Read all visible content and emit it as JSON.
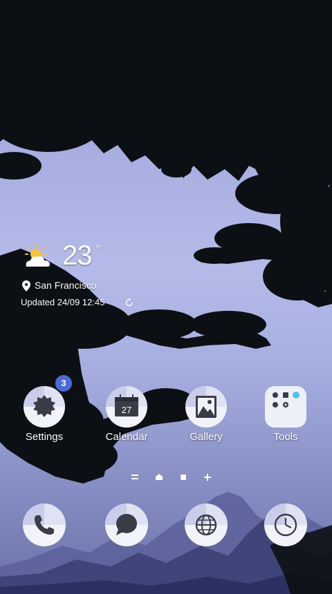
{
  "weather": {
    "temperature": "23",
    "unit": "°",
    "location": "San Francisco",
    "updated": "Updated 24/09 12:45",
    "icon": "partly-sunny-icon"
  },
  "apps": [
    {
      "label": "Settings",
      "icon": "settings-icon",
      "badge": "3"
    },
    {
      "label": "Calendar",
      "icon": "calendar-icon",
      "date": "27"
    },
    {
      "label": "Gallery",
      "icon": "gallery-icon"
    },
    {
      "label": "Tools",
      "icon": "tools-folder-icon"
    }
  ],
  "page_indicator": {
    "items": [
      "menu",
      "home",
      "page",
      "add"
    ]
  },
  "dock": [
    {
      "icon": "phone-icon"
    },
    {
      "icon": "messages-icon"
    },
    {
      "icon": "internet-icon"
    },
    {
      "icon": "clock-icon"
    }
  ],
  "colors": {
    "sky_top": "#8f95d0",
    "sky_mid": "#b4bbe8",
    "badge": "#4a6ad8",
    "icon_bg": "#f2f3f8",
    "icon_accent": "#b9bfe6"
  }
}
